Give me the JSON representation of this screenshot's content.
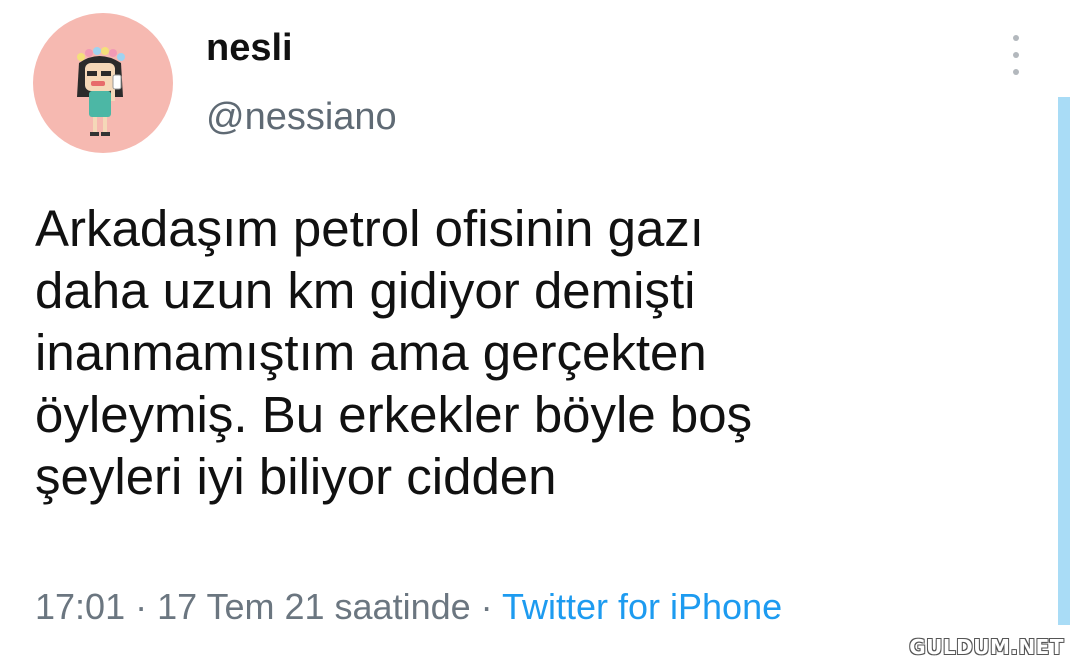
{
  "user": {
    "display_name": "nesli",
    "handle": "@nessiano",
    "avatar_bg": "#f6b9b1"
  },
  "tweet": {
    "lines": [
      "Arkadaşım petrol ofisinin gazı",
      "daha uzun km gidiyor demişti",
      "inanmamıştım ama gerçekten",
      "öyleymiş. Bu erkekler böyle boş",
      "şeyleri iyi biliyor cidden"
    ],
    "timestamp": "17:01 · 17 Tem 21 saatinde",
    "separator": " · ",
    "source": "Twitter for iPhone",
    "source_color": "#1d9bf0"
  },
  "icons": {
    "more": "more-vertical-icon"
  },
  "watermark": "GULDUM.NET"
}
